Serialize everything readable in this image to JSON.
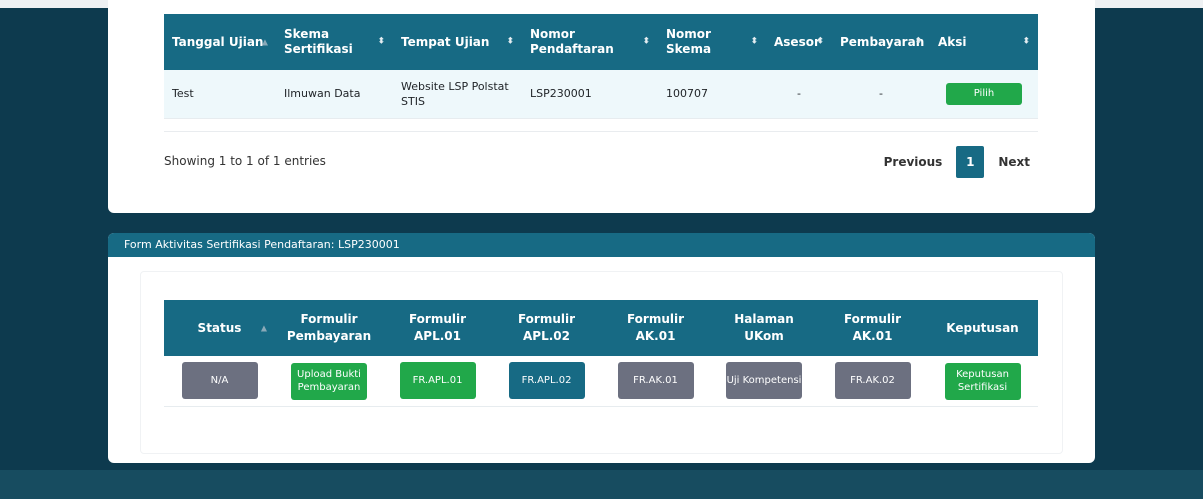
{
  "table1": {
    "headers": [
      {
        "label": "Tanggal Ujian",
        "sort": "asc"
      },
      {
        "label": "Skema Sertifikasi",
        "sort": "both"
      },
      {
        "label": "Tempat Ujian",
        "sort": "both"
      },
      {
        "label": "Nomor Pendaftaran",
        "sort": "both"
      },
      {
        "label": "Nomor Skema",
        "sort": "both"
      },
      {
        "label": "Asesor",
        "sort": "both"
      },
      {
        "label": "Pembayaran",
        "sort": "both"
      },
      {
        "label": "Aksi",
        "sort": "both"
      }
    ],
    "row": {
      "tanggal": "Test",
      "skema": "Ilmuwan Data",
      "tempat": "Website LSP Polstat STIS",
      "nomor_pendaftaran": "LSP230001",
      "nomor_skema": "100707",
      "asesor": "-",
      "pembayaran": "-",
      "aksi": "Pilih"
    },
    "info": "Showing 1 to 1 of 1 entries",
    "pager": {
      "previous": "Previous",
      "current": "1",
      "next": "Next"
    }
  },
  "form": {
    "title": "Form Aktivitas Sertifikasi Pendaftaran: LSP230001",
    "headers": [
      {
        "label": "Status",
        "sort": "asc"
      },
      {
        "label": "Formulir Pembayaran"
      },
      {
        "label": "Formulir APL.01"
      },
      {
        "label": "Formulir APL.02"
      },
      {
        "label": "Formulir AK.01"
      },
      {
        "label": "Halaman UKom"
      },
      {
        "label": "Formulir AK.01"
      },
      {
        "label": "Keputusan"
      }
    ],
    "actions": [
      {
        "label": "N/A",
        "color": "gray"
      },
      {
        "label": "Upload Bukti Pembayaran",
        "color": "green"
      },
      {
        "label": "FR.APL.01",
        "color": "green"
      },
      {
        "label": "FR.APL.02",
        "color": "teal"
      },
      {
        "label": "FR.AK.01",
        "color": "gray"
      },
      {
        "label": "Uji Kompetensi",
        "color": "gray"
      },
      {
        "label": "FR.AK.02",
        "color": "gray"
      },
      {
        "label": "Keputusan Sertifikasi",
        "color": "green"
      }
    ]
  },
  "colors": {
    "background": "#0d3a4e",
    "header": "#176a84",
    "green": "#21a84a",
    "gray": "#6c7080",
    "row_highlight": "#eef8fb"
  }
}
